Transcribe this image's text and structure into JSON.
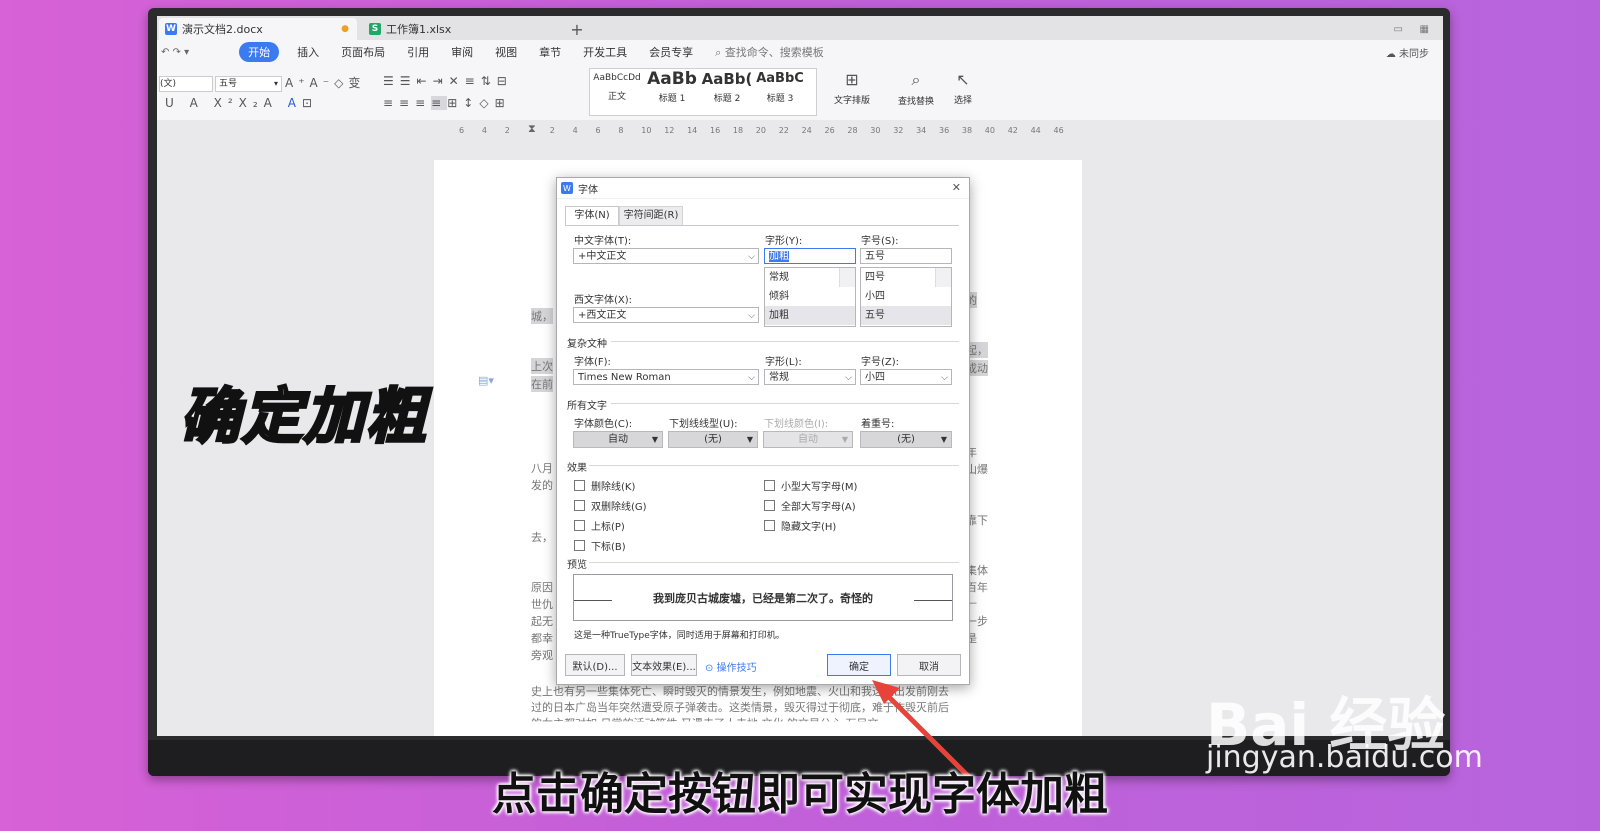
{
  "tabs": {
    "doc": "演示文档2.docx",
    "sheet": "工作簿1.xlsx",
    "doc_icon": "W",
    "sheet_icon": "S",
    "new_tab": "+"
  },
  "menu": {
    "items": [
      "开始",
      "插入",
      "页面布局",
      "引用",
      "审阅",
      "视图",
      "章节",
      "开发工具",
      "会员专享"
    ],
    "search": "查找命令、搜索模板",
    "sync": "未同步"
  },
  "ribbon": {
    "font_name": "(文)",
    "font_size": "五号",
    "styles": [
      {
        "preview": "AaBbCcDd",
        "label": "正文"
      },
      {
        "preview": "AaBb",
        "label": "标题 1"
      },
      {
        "preview": "AaBb(",
        "label": "标题 2"
      },
      {
        "preview": "AaBbC",
        "label": "标题 3"
      }
    ],
    "text_layout": "文字排版",
    "find_replace": "查找替换",
    "select": "选择"
  },
  "ruler": [
    "6",
    "4",
    "2",
    "2",
    "4",
    "6",
    "8",
    "10",
    "12",
    "14",
    "16",
    "18",
    "20",
    "22",
    "24",
    "26",
    "28",
    "30",
    "32",
    "34",
    "36",
    "38",
    "40",
    "42",
    "44",
    "46"
  ],
  "doc_fragments": {
    "l1": "城，",
    "l2": "上次",
    "l3": "在前",
    "l4": "八月",
    "l5": "发的",
    "l6": "去，",
    "l7": "原因",
    "l8": "世仇",
    "l9": "起无",
    "l10": "都幸",
    "l11": "旁观",
    "r1": "的",
    "r2": "起，",
    "r3": "成动",
    "r4": "年",
    "r5": "山爆",
    "r6": "靠下",
    "r7": "集体",
    "r8": "百年",
    "r9": "一步",
    "r10": "是",
    "r11": "—",
    "b1": "史上也有另一些集体死亡、瞬时毁灭的情景发生，例如地震、火山和我这次出发前刚去",
    "b2": "过的日本广岛当年突然遭受原子弹袭击。这类情景，毁灭得过于彻底，难于作毁灭前后",
    "b3": "的女主都对如 日常的活动等性 又遇去了人去地 文化 的文是公心 石目文"
  },
  "dialog": {
    "title": "字体",
    "icon": "W",
    "tab_font": "字体(N)",
    "tab_spacing": "字符间距(R)",
    "cn_font_label": "中文字体(T):",
    "cn_font_value": "+中文正文",
    "style_label": "字形(Y):",
    "style_value": "加粗",
    "style_options": [
      "常规",
      "倾斜",
      "加粗"
    ],
    "size_label": "字号(S):",
    "size_value": "五号",
    "size_options": [
      "四号",
      "小四",
      "五号"
    ],
    "west_font_label": "西文字体(X):",
    "west_font_value": "+西文正文",
    "complex_section": "复杂文种",
    "complex_font_label": "字体(F):",
    "complex_font_value": "Times New Roman",
    "complex_style_label": "字形(L):",
    "complex_style_value": "常规",
    "complex_size_label": "字号(Z):",
    "complex_size_value": "小四",
    "all_text_section": "所有文字",
    "color_label": "字体颜色(C):",
    "color_value": "自动",
    "underline_label": "下划线线型(U):",
    "underline_value": "(无)",
    "underline_color_label": "下划线颜色(I):",
    "underline_color_value": "自动",
    "emphasis_label": "着重号:",
    "emphasis_value": "(无)",
    "effects_section": "效果",
    "effects_left": [
      "删除线(K)",
      "双删除线(G)",
      "上标(P)",
      "下标(B)"
    ],
    "effects_right": [
      "小型大写字母(M)",
      "全部大写字母(A)",
      "隐藏文字(H)"
    ],
    "preview_section": "预览",
    "preview_text": "我到庞贝古城废墟，已经是第二次了。奇怪的",
    "truetype_note": "这是一种TrueType字体，同时适用于屏幕和打印机。",
    "btn_default": "默认(D)...",
    "btn_text_effects": "文本效果(E)...",
    "btn_tips": "操作技巧",
    "btn_ok": "确定",
    "btn_cancel": "取消",
    "close": "✕"
  },
  "overlay_title": "确定加粗",
  "caption": "点击确定按钮即可实现字体加粗",
  "watermark": {
    "brand": "Bai 经验",
    "url": "jingyan.baidu.com"
  },
  "colors": {
    "accent": "#3c7af0",
    "arrow": "#e8433b"
  }
}
